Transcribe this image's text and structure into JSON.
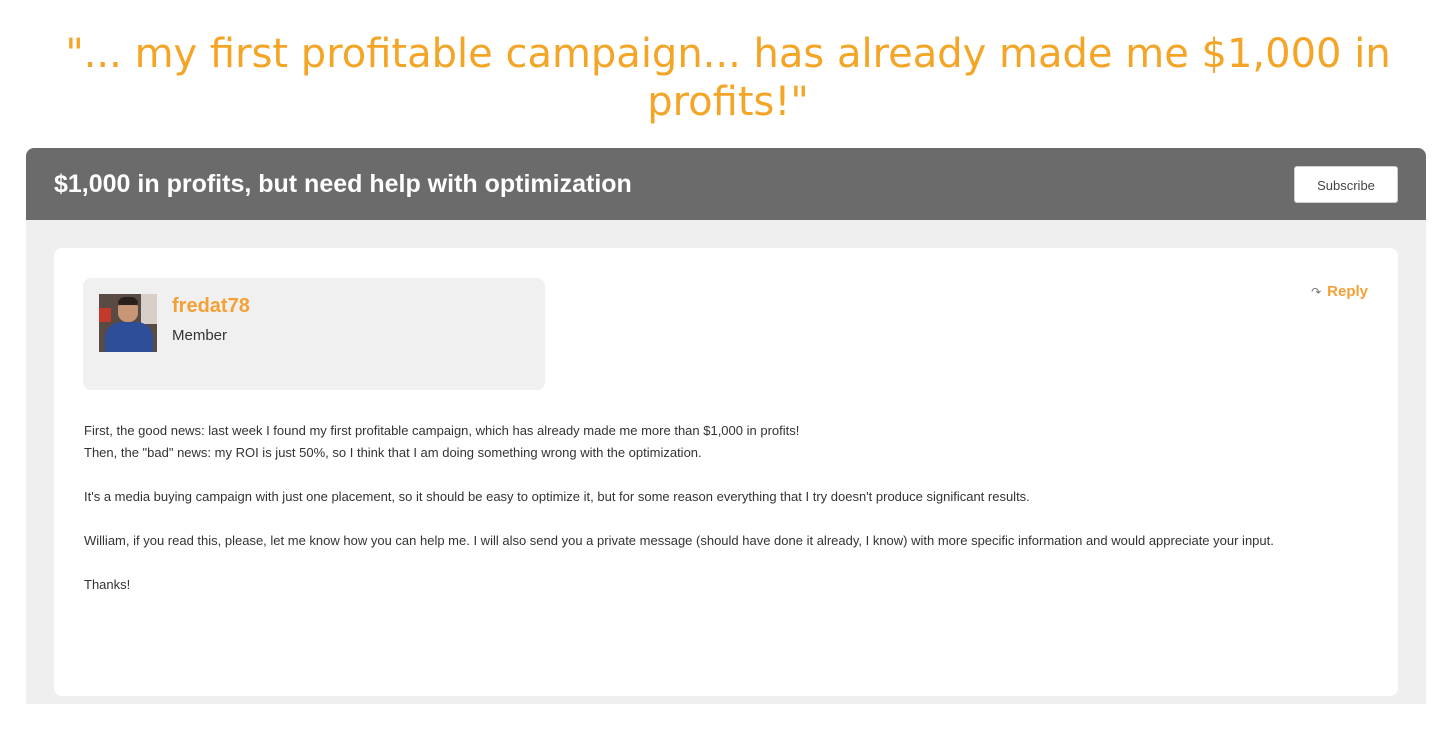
{
  "headline": "\"... my first profitable campaign... has already made me $1,000 in profits!\"",
  "thread": {
    "title": "$1,000 in profits, but need help with optimization",
    "subscribe_label": "Subscribe"
  },
  "post": {
    "author": {
      "name": "fredat78",
      "role": "Member"
    },
    "reply_label": "Reply",
    "reply_icon": "reply-arrow-icon",
    "paragraphs": [
      "First, the good news: last week I found my first profitable campaign, which has already made me more than $1,000 in profits!",
      "Then, the \"bad\" news: my ROI is just 50%, so I think that I am doing something wrong with the optimization.",
      "It's a media buying campaign with just one placement, so it should be easy to optimize it, but for some reason everything that I try doesn't produce significant results.",
      "William, if you read this, please, let me know how you can help me. I will also send you a private message (should have done it already, I know) with more specific information and would appreciate your input.",
      "Thanks!"
    ]
  },
  "colors": {
    "accent": "#f5a526",
    "header_bg": "#6b6b6b",
    "thread_bg": "#efefef"
  }
}
